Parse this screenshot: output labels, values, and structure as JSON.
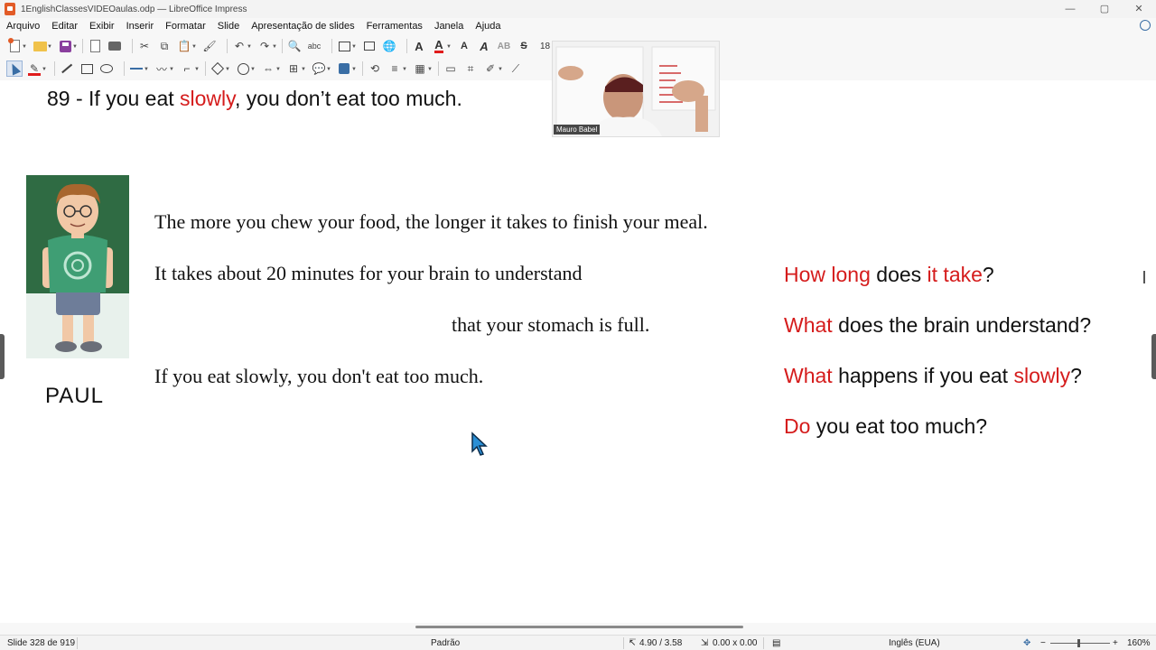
{
  "window": {
    "title": "1EnglishClassesVIDEOaulas.odp — LibreOffice Impress",
    "controls": {
      "minimize": "—",
      "maximize": "▢",
      "close": "✕"
    }
  },
  "menu": [
    "Arquivo",
    "Editar",
    "Exibir",
    "Inserir",
    "Formatar",
    "Slide",
    "Apresentação de slides",
    "Ferramentas",
    "Janela",
    "Ajuda"
  ],
  "toolbar": {
    "font_size": "18"
  },
  "slide": {
    "heading": {
      "prefix": "89 -  If you eat ",
      "highlight": "slowly",
      "suffix": ", you don’t eat too much."
    },
    "character_name": "PAUL",
    "body_lines": [
      "The more you chew your food, the longer it takes to finish your meal.",
      "It takes about 20 minutes for your brain to understand",
      "that your stomach is full.",
      "If you eat slowly, you don't eat too much."
    ],
    "questions": [
      {
        "parts": [
          {
            "t": "How long",
            "red": true
          },
          {
            "t": " does ",
            "red": false
          },
          {
            "t": "it take",
            "red": true
          },
          {
            "t": "?",
            "red": false
          }
        ]
      },
      {
        "parts": [
          {
            "t": "What",
            "red": true
          },
          {
            "t": " does the brain understand?",
            "red": false
          }
        ]
      },
      {
        "parts": [
          {
            "t": "What",
            "red": true
          },
          {
            "t": " happens if you eat ",
            "red": false
          },
          {
            "t": "slowly",
            "red": true
          },
          {
            "t": "?",
            "red": false
          }
        ]
      },
      {
        "parts": [
          {
            "t": "Do",
            "red": true
          },
          {
            "t": " you eat too much?",
            "red": false
          }
        ]
      }
    ]
  },
  "webcam": {
    "presenter_name": "Mauro Babel"
  },
  "status": {
    "slide_info": "Slide 328 de 919",
    "layout": "Padrão",
    "position": "4.90 / 3.58",
    "size": "0.00 x 0.00",
    "language": "Inglês (EUA)",
    "zoom": "160%"
  },
  "colors": {
    "accent_red": "#d51c1c",
    "app_orange": "#e25b27"
  }
}
